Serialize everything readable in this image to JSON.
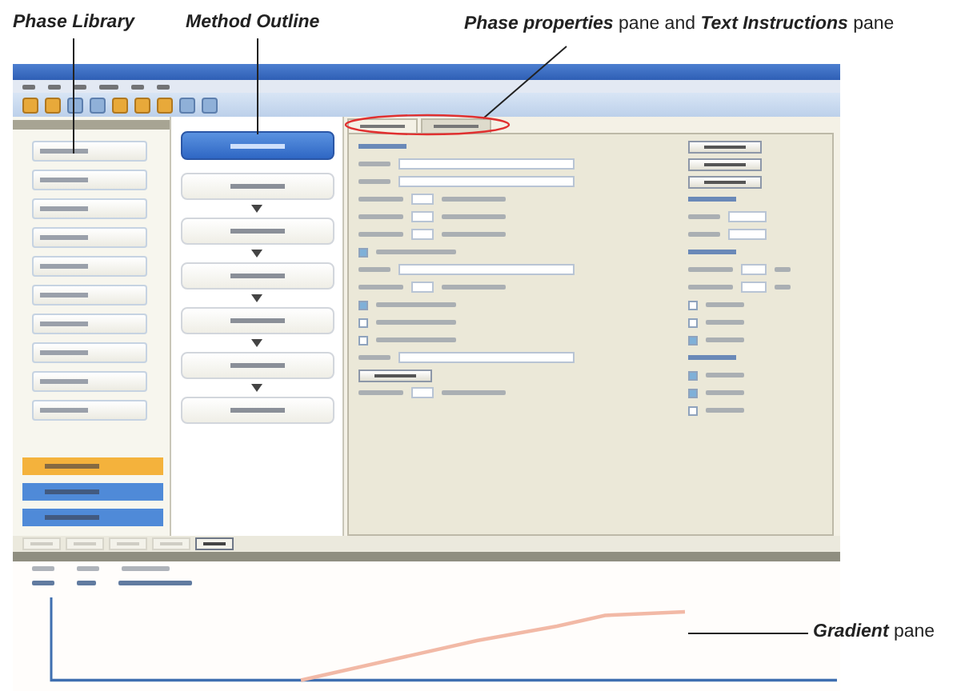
{
  "callouts": [
    {
      "kind": "library",
      "text": "Phase Library"
    },
    {
      "kind": "outline",
      "text": "Method Outline"
    },
    {
      "kind": "properties",
      "text": "**Phase properties** pane and **Text Instructions** pane"
    },
    {
      "kind": "gradient",
      "text": "**Gradient** pane"
    }
  ],
  "toolbar": {
    "icons": [
      {
        "kind": "folder"
      },
      {
        "kind": "folder"
      },
      {
        "kind": "page"
      },
      {
        "kind": "page"
      },
      {
        "kind": "folder"
      },
      {
        "kind": "folder"
      },
      {
        "kind": "folder"
      },
      {
        "kind": "page"
      },
      {
        "kind": "page"
      }
    ]
  },
  "phase_library": {
    "items": [
      {
        "kind": "phase"
      },
      {
        "kind": "phase"
      },
      {
        "kind": "phase"
      },
      {
        "kind": "phase"
      },
      {
        "kind": "phase"
      },
      {
        "kind": "phase"
      },
      {
        "kind": "phase"
      },
      {
        "kind": "phase"
      },
      {
        "kind": "phase"
      },
      {
        "kind": "phase"
      }
    ],
    "groups": [
      {
        "color": "#f4b23c"
      },
      {
        "color": "#4f8ad8"
      },
      {
        "color": "#4f8ad8"
      }
    ]
  },
  "method_outline": {
    "blocks": [
      {
        "selected": true
      },
      {
        "selected": false
      },
      {
        "selected": false
      },
      {
        "selected": false
      },
      {
        "selected": false
      },
      {
        "selected": false
      },
      {
        "selected": false
      }
    ]
  },
  "properties": {
    "tabs": [
      {
        "selected": true
      },
      {
        "selected": false
      }
    ],
    "left_rows": [
      {
        "kind": "heading"
      },
      {
        "kind": "select"
      },
      {
        "kind": "select"
      },
      {
        "kind": "input"
      },
      {
        "kind": "input"
      },
      {
        "kind": "input"
      },
      {
        "kind": "checkbox",
        "checked": true
      },
      {
        "kind": "select"
      },
      {
        "kind": "input"
      },
      {
        "kind": "checkbox",
        "checked": true
      },
      {
        "kind": "checkbox",
        "checked": false
      },
      {
        "kind": "checkbox",
        "checked": false
      },
      {
        "kind": "select"
      },
      {
        "kind": "button"
      },
      {
        "kind": "input"
      }
    ],
    "right_rows": [
      {
        "kind": "button"
      },
      {
        "kind": "button"
      },
      {
        "kind": "button"
      },
      {
        "kind": "heading"
      },
      {
        "kind": "select"
      },
      {
        "kind": "select"
      },
      {
        "kind": "heading"
      },
      {
        "kind": "input"
      },
      {
        "kind": "input"
      },
      {
        "kind": "checkbox",
        "checked": false
      },
      {
        "kind": "checkbox",
        "checked": false
      },
      {
        "kind": "checkbox",
        "checked": true
      },
      {
        "kind": "heading"
      },
      {
        "kind": "checkbox",
        "checked": true
      },
      {
        "kind": "checkbox",
        "checked": true
      },
      {
        "kind": "checkbox",
        "checked": false
      }
    ]
  },
  "bottom_buttons": [
    {
      "disabled": true
    },
    {
      "disabled": true
    },
    {
      "disabled": true
    },
    {
      "disabled": true
    },
    {
      "disabled": false
    }
  ]
}
